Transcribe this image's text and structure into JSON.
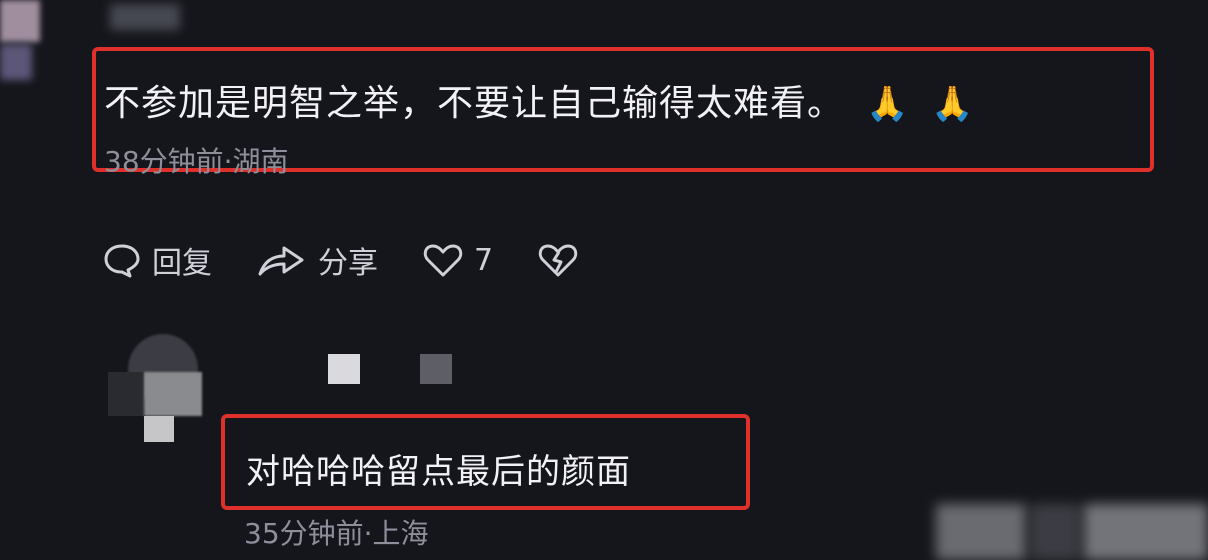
{
  "comment1": {
    "text": "不参加是明智之举，不要让自己输得太难看。",
    "emojis": [
      "🙏",
      "🙏"
    ],
    "meta": "38分钟前·湖南"
  },
  "actions": {
    "reply_label": "回复",
    "share_label": "分享",
    "like_count": "7",
    "icons": [
      "comment-bubble-icon",
      "share-arrow-icon",
      "heart-icon",
      "broken-heart-icon"
    ]
  },
  "comment2": {
    "text": "对哈哈哈留点最后的颜面",
    "meta": "35分钟前·上海"
  },
  "colors": {
    "background": "#15161c",
    "highlight_border": "#e0302c",
    "meta_text": "#8d8f9a"
  }
}
